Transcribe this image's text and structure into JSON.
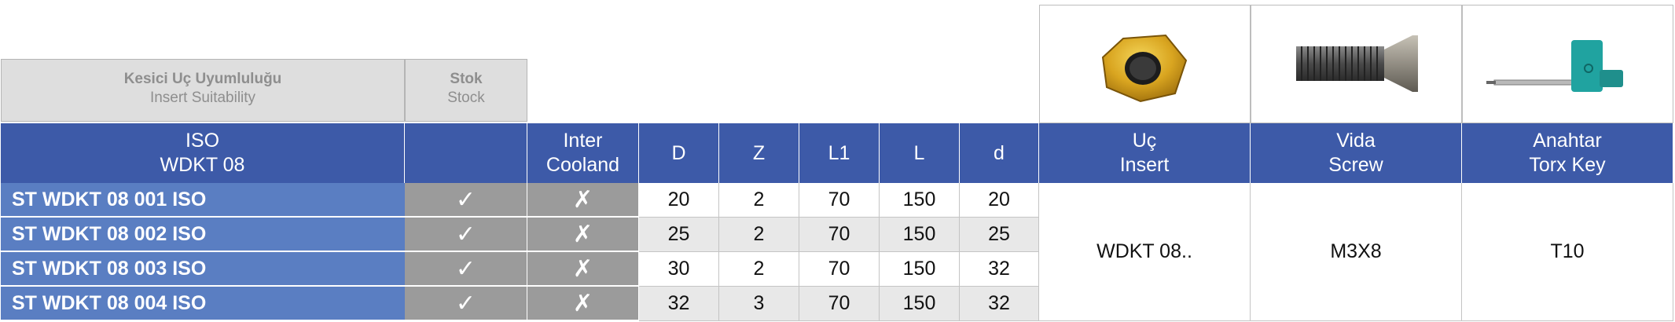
{
  "group_headers": {
    "insert_suitability": {
      "tr": "Kesici Uç Uyumluluğu",
      "en": "Insert Suitability"
    },
    "stock": {
      "tr": "Stok",
      "en": "Stock"
    }
  },
  "columns": {
    "iso": [
      "ISO",
      "WDKT 08"
    ],
    "stock": "",
    "coolant": [
      "Inter",
      "Cooland"
    ],
    "D": "D",
    "Z": "Z",
    "L1": "L1",
    "L": "L",
    "d": "d",
    "insert": [
      "Uç",
      "Insert"
    ],
    "screw": [
      "Vida",
      "Screw"
    ],
    "key": [
      "Anahtar",
      "Torx Key"
    ]
  },
  "accessories": {
    "insert": "WDKT 08..",
    "screw": "M3X8",
    "key": "T10"
  },
  "accessory_images": {
    "insert": "insert-image",
    "screw": "screw-image",
    "key": "torx-key-image"
  },
  "rows": [
    {
      "code": "ST WDKT 08 001 ISO",
      "stock": "✓",
      "coolant": "✗",
      "D": "20",
      "Z": "2",
      "L1": "70",
      "L": "150",
      "d": "20"
    },
    {
      "code": "ST WDKT 08 002 ISO",
      "stock": "✓",
      "coolant": "✗",
      "D": "25",
      "Z": "2",
      "L1": "70",
      "L": "150",
      "d": "25"
    },
    {
      "code": "ST WDKT 08 003 ISO",
      "stock": "✓",
      "coolant": "✗",
      "D": "30",
      "Z": "2",
      "L1": "70",
      "L": "150",
      "d": "32"
    },
    {
      "code": "ST WDKT 08 004 ISO",
      "stock": "✓",
      "coolant": "✗",
      "D": "32",
      "Z": "3",
      "L1": "70",
      "L": "150",
      "d": "32"
    }
  ],
  "colors": {
    "header_blue": "#3d5aa8",
    "code_blue": "#5a7ec2",
    "mark_gray": "#9b9b9b",
    "group_header_gray": "#dedede"
  }
}
